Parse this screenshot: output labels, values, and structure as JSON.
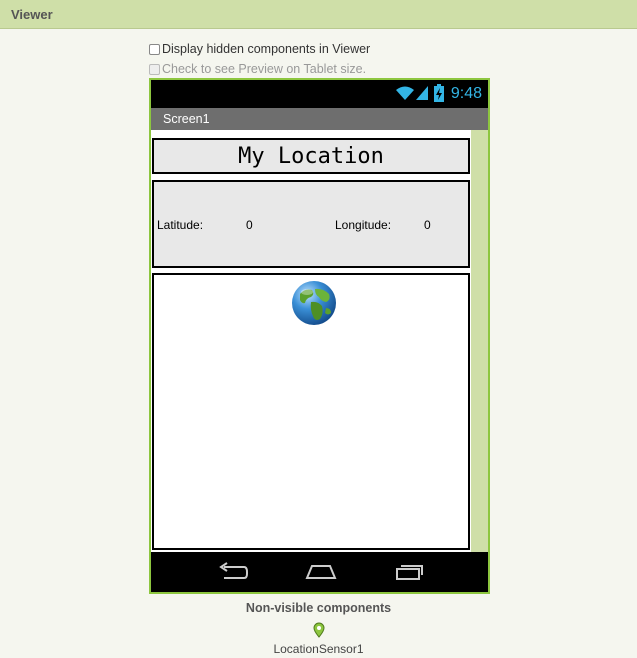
{
  "viewer": {
    "title": "Viewer",
    "display_hidden_label": "Display hidden components in Viewer",
    "tablet_preview_label": "Check to see Preview on Tablet size."
  },
  "phone": {
    "status_time": "9:48",
    "screen_title": "Screen1",
    "label_text": "My Location",
    "latitude_label": "Latitude:",
    "latitude_value": "0",
    "longitude_label": "Longitude:",
    "longitude_value": "0"
  },
  "non_visible": {
    "title": "Non-visible components",
    "items": [
      {
        "label": "LocationSensor1",
        "icon": "location-pin-icon"
      }
    ]
  },
  "colors": {
    "header_bg": "#cfdfa8",
    "phone_border": "#8dc63f",
    "status_time": "#33b5e5",
    "title_bar": "#6e6e6e"
  }
}
